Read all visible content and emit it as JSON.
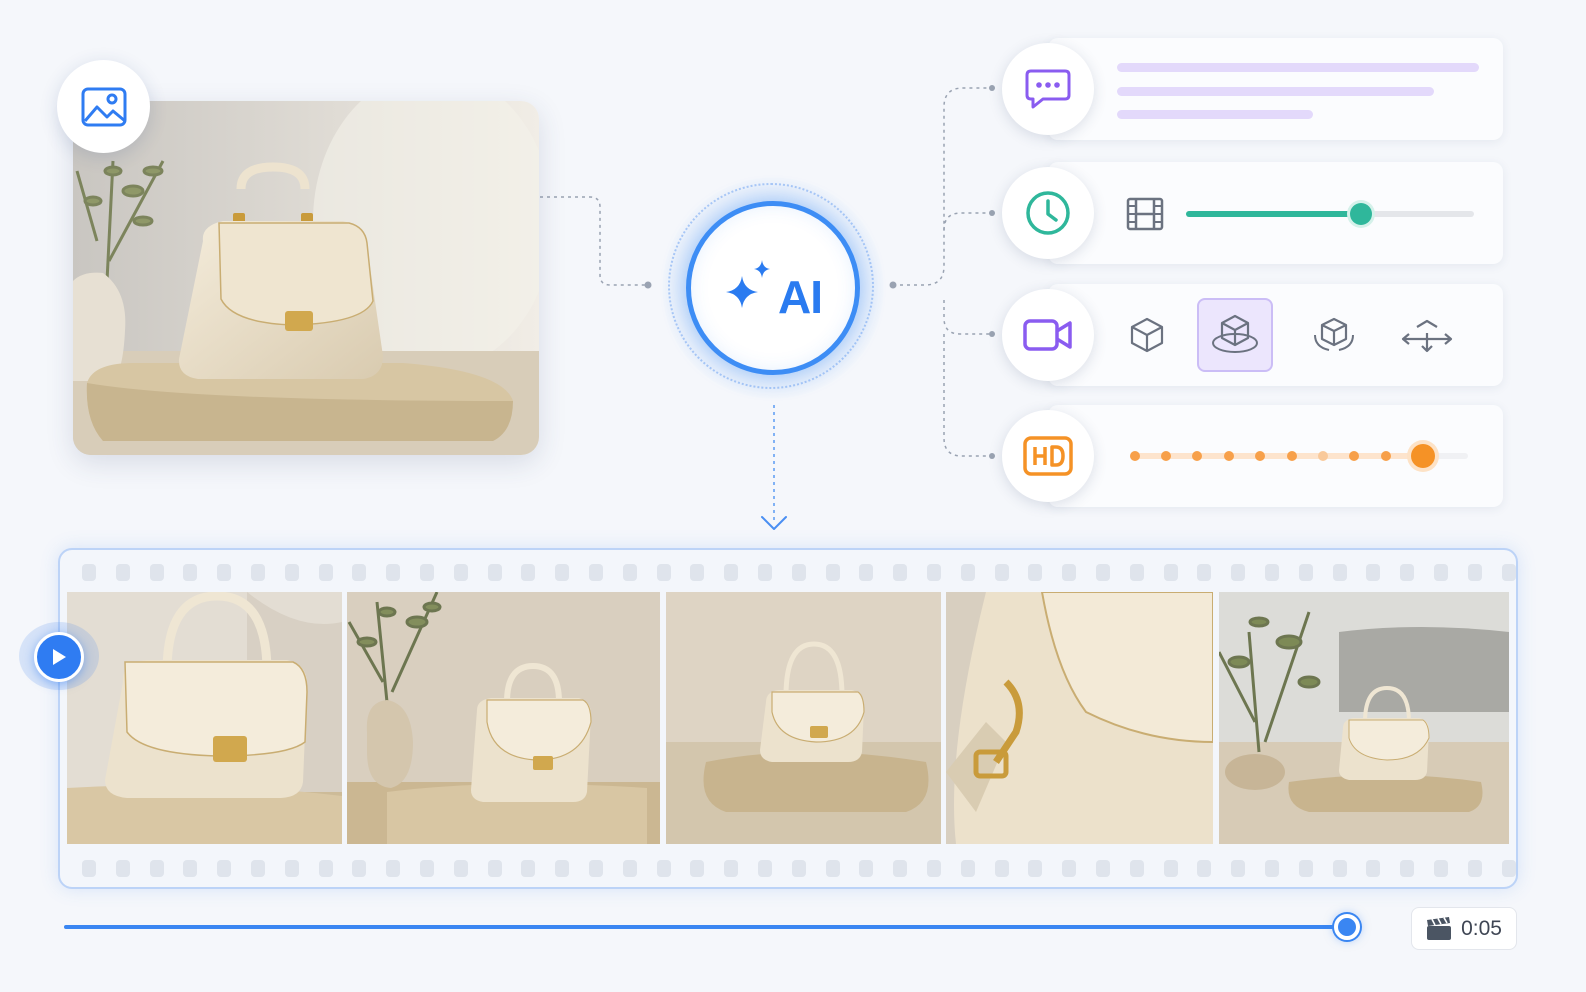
{
  "hub": {
    "label": "AI"
  },
  "timeline": {
    "time": "0:05",
    "progress": 0.96
  },
  "motion_slider": {
    "value": 0.6
  },
  "quality_slider": {
    "value": 1.0
  },
  "camera_modes": {
    "selected_index": 1
  },
  "icons": {
    "image": "image-icon",
    "chat": "chat-bubble-icon",
    "clock": "clock-icon",
    "film": "film-icon",
    "camera": "video-camera-icon",
    "hd": "hd-icon",
    "play": "play-icon",
    "clapper": "clapperboard-icon"
  },
  "colors": {
    "accent_blue": "#3d8df5",
    "purple": "#8a5cf0",
    "teal": "#2fb79b",
    "orange": "#f59226"
  }
}
